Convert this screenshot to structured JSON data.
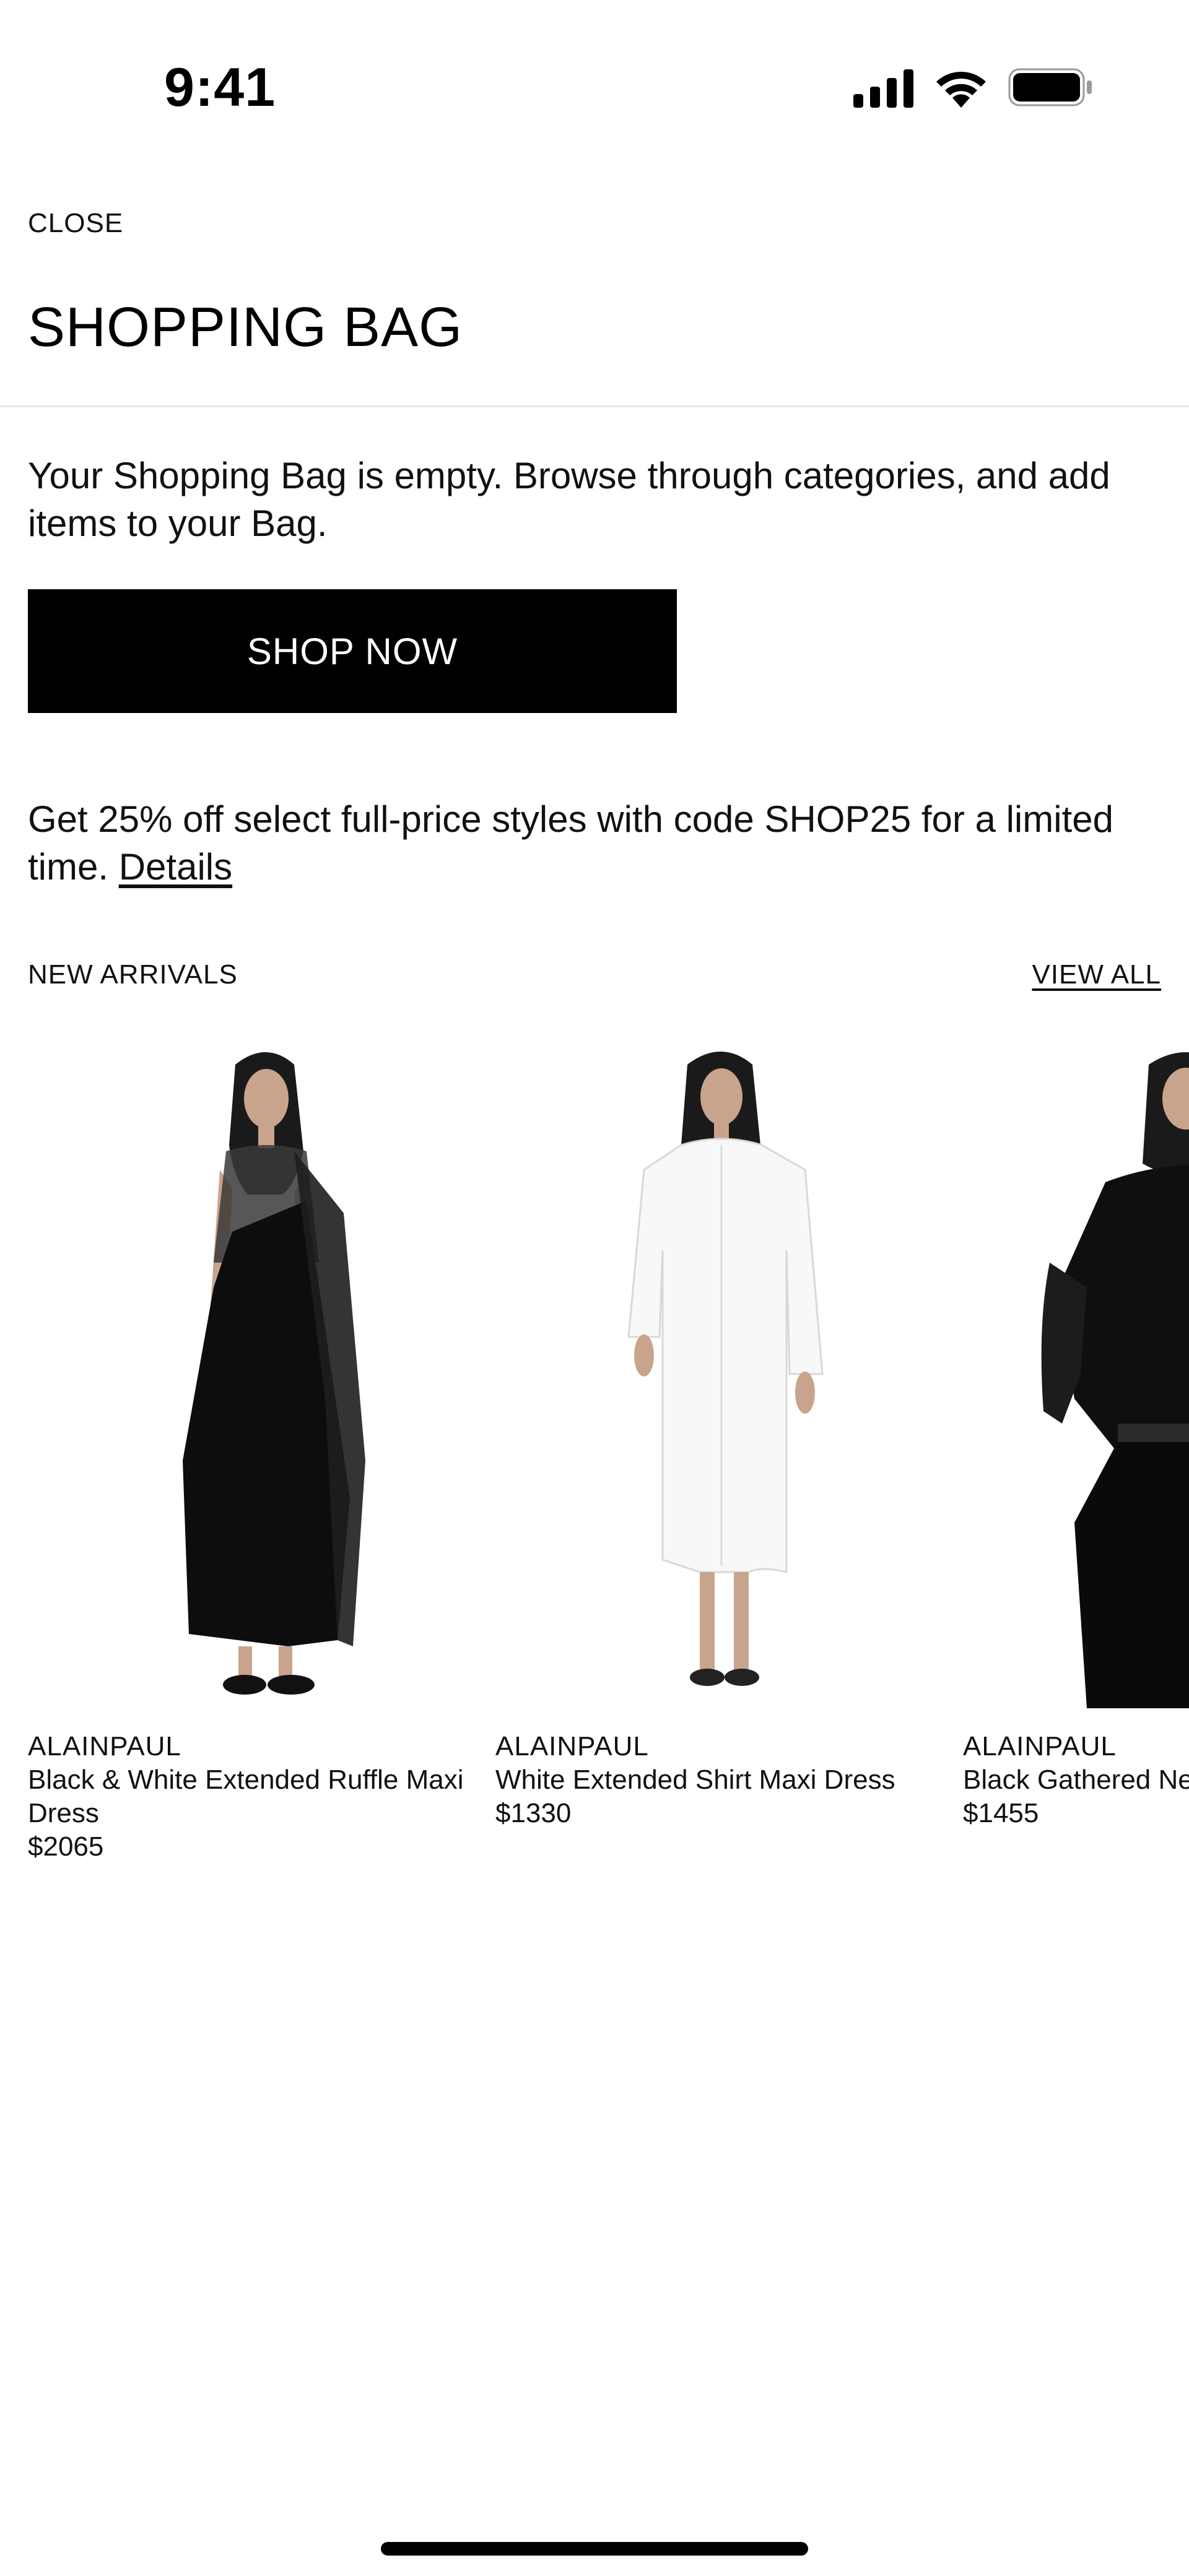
{
  "status_bar": {
    "time": "9:41",
    "icons": [
      "signal-icon",
      "wifi-icon",
      "battery-icon"
    ]
  },
  "header": {
    "close_label": "CLOSE",
    "title": "SHOPPING BAG"
  },
  "empty_state": {
    "message": "Your Shopping Bag is empty. Browse through categories, and add items to your Bag.",
    "button_label": "SHOP NOW"
  },
  "promo": {
    "text": "Get 25% off select full-price styles with code SHOP25 for a limited time.",
    "link_label": "Details"
  },
  "new_arrivals": {
    "title": "NEW ARRIVALS",
    "view_all_label": "VIEW ALL",
    "products": [
      {
        "brand": "ALAINPAUL",
        "name": "Black & White Extended Ruffle Maxi Dress",
        "price": "$2065"
      },
      {
        "brand": "ALAINPAUL",
        "name": "White Extended Shirt Maxi Dress",
        "price": "$1330"
      },
      {
        "brand": "ALAINPAUL",
        "name": "Black Gathered Ne",
        "price": "$1455"
      }
    ]
  },
  "colors": {
    "background": "#ffffff",
    "text": "#111111",
    "button_background": "#000000",
    "button_text": "#ffffff",
    "divider": "#e6e6e6"
  }
}
